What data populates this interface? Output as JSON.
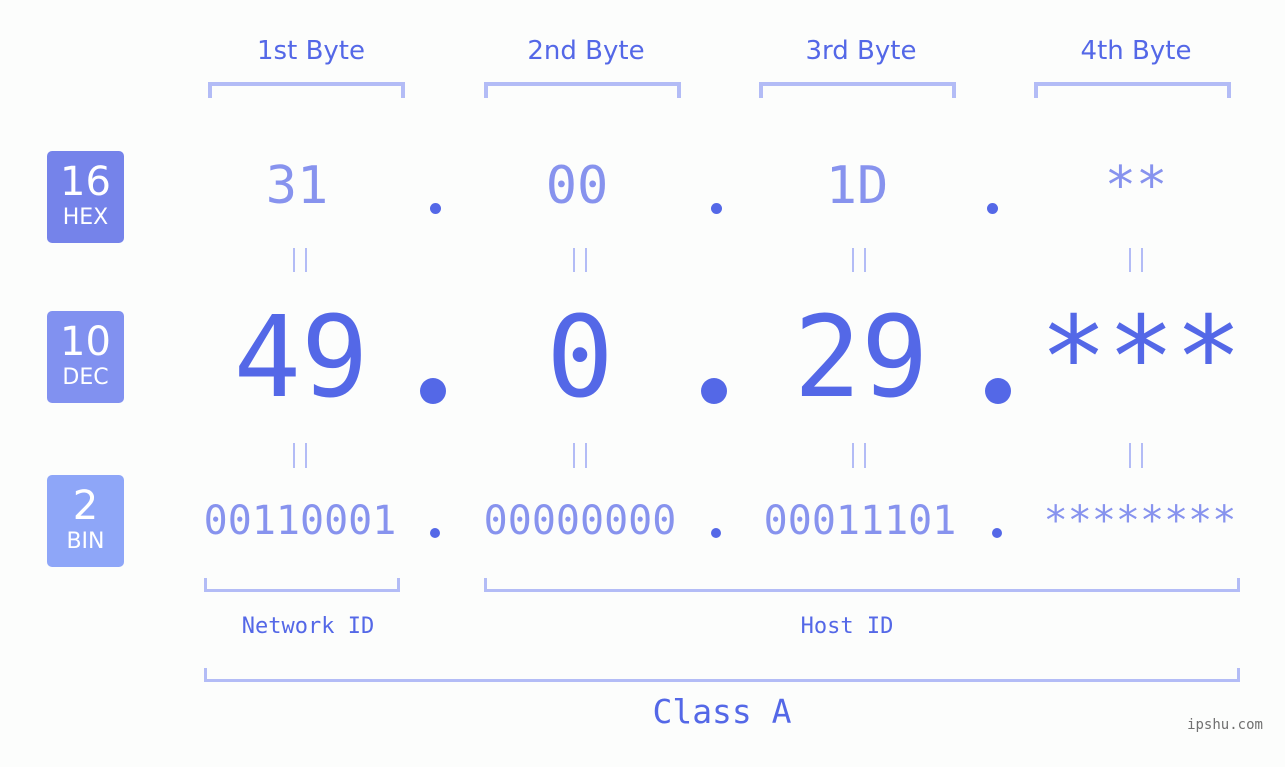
{
  "bases": [
    {
      "num": "16",
      "label": "HEX",
      "color": "#7583ea"
    },
    {
      "num": "10",
      "label": "DEC",
      "color": "#8191f0"
    },
    {
      "num": "2",
      "label": "BIN",
      "color": "#8ea6f8"
    }
  ],
  "byte_headers": [
    "1st Byte",
    "2nd Byte",
    "3rd Byte",
    "4th Byte"
  ],
  "hex": [
    "31",
    "00",
    "1D",
    "**"
  ],
  "dec": [
    "49",
    "0",
    "29",
    "***"
  ],
  "bin": [
    "00110001",
    "00000000",
    "00011101",
    "********"
  ],
  "separator": ".",
  "network_label": "Network ID",
  "host_label": "Host ID",
  "class_label": "Class A",
  "watermark": "ipshu.com",
  "colors": {
    "accent": "#5468e7",
    "light": "#8793ee",
    "bracket": "#b3bcf6"
  }
}
